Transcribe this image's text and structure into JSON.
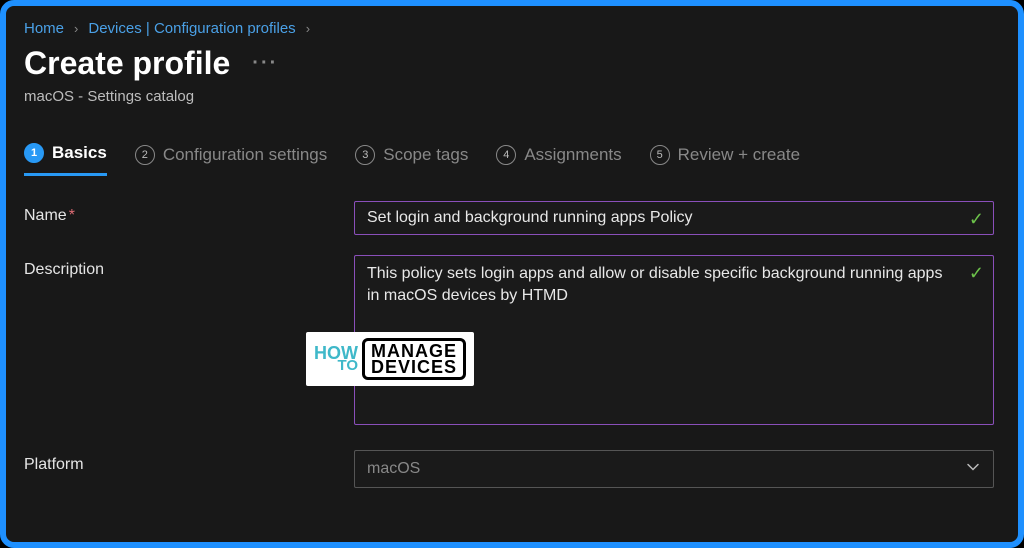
{
  "breadcrumb": {
    "home": "Home",
    "devices": "Devices | Configuration profiles"
  },
  "header": {
    "title": "Create profile",
    "subtitle": "macOS - Settings catalog"
  },
  "wizard": {
    "steps": [
      {
        "num": "1",
        "label": "Basics"
      },
      {
        "num": "2",
        "label": "Configuration settings"
      },
      {
        "num": "3",
        "label": "Scope tags"
      },
      {
        "num": "4",
        "label": "Assignments"
      },
      {
        "num": "5",
        "label": "Review + create"
      }
    ]
  },
  "form": {
    "name_label": "Name",
    "name_value": "Set login and background running apps Policy",
    "description_label": "Description",
    "description_value": "This policy sets login apps and allow or disable specific background running apps in macOS devices by HTMD",
    "platform_label": "Platform",
    "platform_value": "macOS"
  },
  "logo": {
    "how": "HOW",
    "to": "TO",
    "line1": "MANAGE",
    "line2": "DEVICES"
  }
}
